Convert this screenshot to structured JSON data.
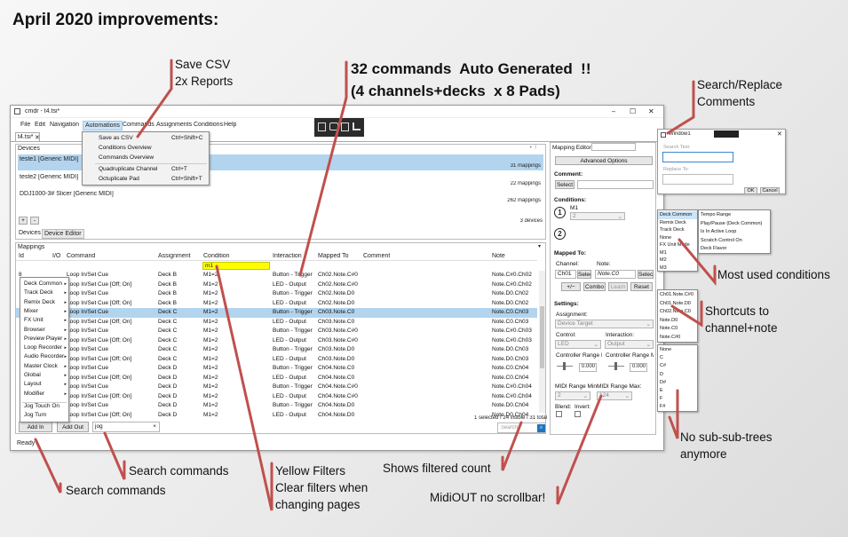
{
  "slide_title": "April 2020 improvements:",
  "callouts": {
    "save_csv": "Save CSV\n2x Reports",
    "auto_generated": "32 commands  Auto Generated  !!\n(4 channels+decks  x 8 Pads)",
    "search_replace": "Search/Replace\nComments",
    "most_used": "Most used conditions",
    "shortcuts": "Shortcuts to\nchannel+note",
    "no_sub_trees": "No sub-sub-trees\nanymore",
    "search_commands_1": "Search commands",
    "search_commands_2": "Search commands",
    "yellow_filters": "Yellow Filters\nClear filters when\nchanging pages",
    "filtered_count": "Shows filtered count",
    "midiout": "MidiOUT no scrollbar!"
  },
  "accent_color": "#c0504d",
  "window": {
    "title": "cmdr - t4.tsi*",
    "controls": {
      "minimize": "–",
      "maximize": "☐",
      "close": "✕"
    },
    "menu": [
      "File",
      "Edit",
      "Navigation",
      "Automations",
      "Commands",
      "Assignments",
      "Conditions",
      "Help"
    ],
    "automations_menu": [
      {
        "label": "Save as CSV",
        "shortcut": "Ctrl+Shift+C"
      },
      {
        "label": "Conditions Overview",
        "shortcut": ""
      },
      {
        "label": "Commands Overview",
        "shortcut": ""
      },
      {
        "label": "Quadruplicate Channel",
        "shortcut": "Ctrl+T"
      },
      {
        "label": "Octuplicate Pad",
        "shortcut": "Ctrl+Shift+T"
      }
    ],
    "doc_tab": "t4.tsi*",
    "devices": {
      "header": "Devices",
      "items": [
        {
          "name": "teste1 [Generic MIDI]",
          "count": "31 mappings"
        },
        {
          "name": "teste2 [Generic MIDI]",
          "count": "22 mappings"
        },
        {
          "name": "DDJ1000-3# Slicer [Generic MIDI]",
          "count": "262 mappings"
        }
      ],
      "add": "+",
      "remove": "-",
      "total": "3 devices",
      "tabs": [
        "Devices",
        "Device Editor"
      ]
    },
    "mappings": {
      "header": "Mappings",
      "columns": [
        "Id",
        "I/O",
        "Command",
        "Assignment",
        "Condition",
        "Interaction",
        "Mapped To",
        "Comment",
        "Note"
      ],
      "filter_value": "m1",
      "rows": [
        [
          "8",
          "",
          "Loop In/Set Cue",
          "Deck B",
          "M1=2",
          "Button - Trigger",
          "Ch02.Note.C#0",
          "",
          "Note.C#0.Ch02"
        ],
        [
          "",
          "",
          "Loop In/Set Cue [Off; On]",
          "Deck B",
          "M1=2",
          "LED - Output",
          "Ch02.Note.C#0",
          "",
          "Note.C#0.Ch02"
        ],
        [
          "",
          "",
          "Loop In/Set Cue",
          "Deck B",
          "M1=2",
          "Button - Trigger",
          "Ch02.Note.D0",
          "",
          "Note.D0.Ch02"
        ],
        [
          "",
          "",
          "Loop In/Set Cue [Off; On]",
          "Deck B",
          "M1=2",
          "LED - Output",
          "Ch02.Note.D0",
          "",
          "Note.D0.Ch02"
        ],
        [
          "",
          "",
          "Loop In/Set Cue",
          "Deck C",
          "M1=2",
          "Button - Trigger",
          "Ch03.Note.C0",
          "",
          "Note.C0.Ch03"
        ],
        [
          "",
          "",
          "Loop In/Set Cue [Off; On]",
          "Deck C",
          "M1=2",
          "LED - Output",
          "Ch03.Note.C0",
          "",
          "Note.C0.Ch03"
        ],
        [
          "",
          "",
          "Loop In/Set Cue",
          "Deck C",
          "M1=2",
          "Button - Trigger",
          "Ch03.Note.C#0",
          "",
          "Note.C#0.Ch03"
        ],
        [
          "",
          "",
          "Loop In/Set Cue [Off; On]",
          "Deck C",
          "M1=2",
          "LED - Output",
          "Ch03.Note.C#0",
          "",
          "Note.C#0.Ch03"
        ],
        [
          "",
          "",
          "Loop In/Set Cue",
          "Deck C",
          "M1=2",
          "Button - Trigger",
          "Ch03.Note.D0",
          "",
          "Note.D0.Ch03"
        ],
        [
          "",
          "",
          "Loop In/Set Cue [Off; On]",
          "Deck C",
          "M1=2",
          "LED - Output",
          "Ch03.Note.D0",
          "",
          "Note.D0.Ch03"
        ],
        [
          "",
          "",
          "Loop In/Set Cue",
          "Deck D",
          "M1=2",
          "Button - Trigger",
          "Ch04.Note.C0",
          "",
          "Note.C0.Ch04"
        ],
        [
          "",
          "",
          "Loop In/Set Cue [Off; On]",
          "Deck D",
          "M1=2",
          "LED - Output",
          "Ch04.Note.C0",
          "",
          "Note.C0.Ch04"
        ],
        [
          "",
          "",
          "Loop In/Set Cue",
          "Deck D",
          "M1=2",
          "Button - Trigger",
          "Ch04.Note.C#0",
          "",
          "Note.C#0.Ch04"
        ],
        [
          "",
          "",
          "Loop In/Set Cue [Off; On]",
          "Deck D",
          "M1=2",
          "LED - Output",
          "Ch04.Note.C#0",
          "",
          "Note.C#0.Ch04"
        ],
        [
          "",
          "",
          "Loop In/Set Cue",
          "Deck D",
          "M1=2",
          "Button - Trigger",
          "Ch04.Note.D0",
          "",
          "Note.D0.Ch04"
        ],
        [
          "",
          "",
          "Loop In/Set Cue [Off; On]",
          "Deck D",
          "M1=2",
          "LED - Output",
          "Ch04.Note.D0",
          "",
          "Note.D0.Ch04"
        ]
      ],
      "selected_row": 4,
      "status": "1 selected / 24 visible / 31 total",
      "search_placeholder": "Search"
    },
    "command_menu": [
      "Deck Common",
      "Track Deck",
      "Remix Deck",
      "Mixer",
      "FX Unit",
      "Browser",
      "Preview Player",
      "Loop Recorder",
      "Audio Recorder",
      "Master Clock",
      "Global",
      "Layout",
      "Modifier",
      "Jog Touch On",
      "Jog Turn"
    ],
    "add_in": "Add In",
    "add_out": "Add Out",
    "command_search": "jog",
    "status_bar": "Ready",
    "mapping_editor": {
      "header": "Mapping Editor",
      "advanced": "Advanced Options",
      "comment_label": "Comment:",
      "select": "Select",
      "conditions_label": "Conditions:",
      "cond1_num": "1",
      "cond1_value": "M1",
      "cond1_select": "2",
      "cond2_num": "2",
      "mapped_to_label": "Mapped To:",
      "channel_label": "Channel:",
      "note_label": "Note:",
      "channel_value": "Ch01",
      "note_value": "Note.C0",
      "plusminus": "+/−",
      "combo": "Combo",
      "learn": "Learn",
      "reset": "Reset",
      "settings_label": "Settings:",
      "assignment_label": "Assignment:",
      "assignment_value": "Device Target",
      "control_label": "Control:",
      "interaction_label": "Interaction:",
      "control_value": "LED",
      "interaction_value": "Output",
      "range_min_label": "Controller Range M",
      "range_max_label": "Controller Range M",
      "range_min": "0.000",
      "range_max": "0.000",
      "midi_min_label": "MIDI Range Min:",
      "midi_max_label": "MIDI Range Max:",
      "midi_min": "2",
      "midi_max": "124",
      "blend": "Blend:",
      "invert": "Invert:"
    },
    "search_window": {
      "title": "Window1",
      "search_label": "Search Text:",
      "replace_label": "Replace To:",
      "ok": "OK",
      "cancel": "Cancel"
    },
    "conditions_popup": {
      "left": [
        "Deck Common",
        "Remix Deck",
        "Track Deck",
        "None",
        "FX Unit Mode",
        "M1",
        "M2",
        "M3"
      ],
      "right": [
        "Tempo Range",
        "Play/Pause (Deck Common)",
        "Is In Active Loop",
        "Scratch Control On",
        "Deck Flavor"
      ]
    },
    "shortcuts_popup": [
      "Ch01.Note.C#0",
      "Ch01.Note.D0",
      "Ch02.Note.C0",
      "Note.D0",
      "Note.C0",
      "Note.C#0"
    ],
    "notes_popup": [
      "None",
      "C",
      "C#",
      "D",
      "D#",
      "E",
      "F",
      "F#"
    ]
  }
}
